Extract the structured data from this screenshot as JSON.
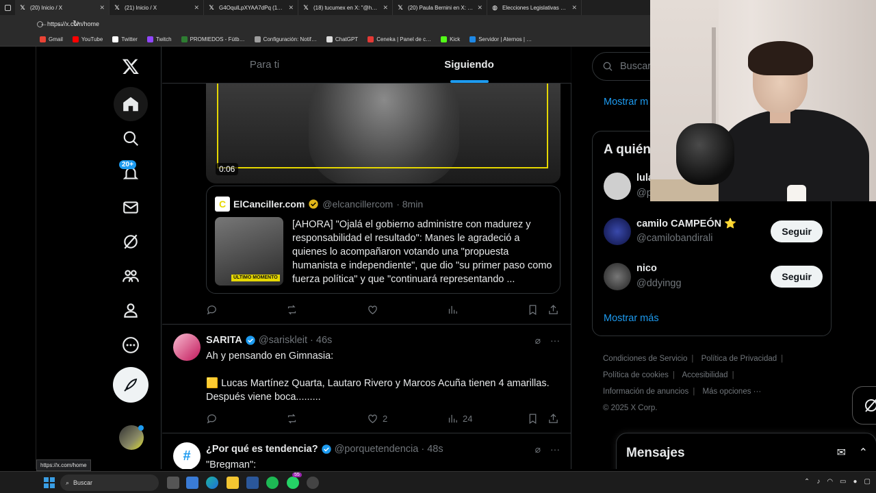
{
  "browser": {
    "tabs": [
      {
        "title": "(20) Inicio / X",
        "icon": "x-logo-icon",
        "active": true
      },
      {
        "title": "(21) Inicio / X",
        "icon": "x-logo-icon"
      },
      {
        "title": "G4OqulLpXYAA7dPq (1152…",
        "icon": "x-logo-icon"
      },
      {
        "title": "(18) tucumex en X: \"@hail_…",
        "icon": "x-logo-icon"
      },
      {
        "title": "(20) Paula Bernini en X: \"GA…",
        "icon": "x-logo-icon"
      },
      {
        "title": "Elecciones Legislativas 2025",
        "icon": "globe-icon"
      }
    ],
    "url": "https://x.com/home",
    "bookmarks": [
      {
        "label": "Gmail",
        "color": "#ea4335"
      },
      {
        "label": "YouTube",
        "color": "#ff0000"
      },
      {
        "label": "Twitter",
        "color": "#ffffff"
      },
      {
        "label": "Twitch",
        "color": "#9146ff"
      },
      {
        "label": "PROMIEDOS - Fútb…",
        "color": "#2e7d32"
      },
      {
        "label": "Configuración: Notif…",
        "color": "#9e9e9e"
      },
      {
        "label": "ChatGPT",
        "color": "#dddddd"
      },
      {
        "label": "Ceneka | Panel de c…",
        "color": "#e53935"
      },
      {
        "label": "Kick",
        "color": "#53fc18"
      },
      {
        "label": "Servidor | Aternos | …",
        "color": "#1e88e5"
      }
    ],
    "status_url": "https://x.com/home"
  },
  "nav": {
    "notifications_badge": "20+"
  },
  "feed": {
    "tabs": [
      "Para ti",
      "Siguiendo"
    ],
    "active_tab": "Siguiendo",
    "video_time": "0:06",
    "quote": {
      "logo_letter": "C",
      "name": "ElCanciller.com",
      "handle": "@elcancillercom",
      "time": "· 8min",
      "thumb_tag": "ÚLTIMO MOMENTO",
      "text": "[AHORA] \"Ojalá el gobierno administre con madurez y responsabilidad el resultado\": Manes le agradeció a quienes lo acompañaron votando una \"propuesta humanista e independiente\", que dio \"su primer paso como fuerza política\" y que \"continuará representando ..."
    },
    "tweets": [
      {
        "name": "SARITA",
        "handle": "@sariskleit",
        "time": "· 46s",
        "text_1": "Ah y pensando en Gimnasia:",
        "text_2": "🟨 Lucas Martínez Quarta, Lautaro Rivero y Marcos Acuña tienen 4 amarillas. Después viene boca.........",
        "likes": "2",
        "views": "24"
      },
      {
        "name": "¿Por qué es tendencia?",
        "handle": "@porquetendencia",
        "time": "· 48s",
        "text_1": "\"Bregman\":"
      }
    ]
  },
  "right": {
    "search_placeholder": "Buscar",
    "show_more_top": "Mostrar m",
    "who_title": "A quién",
    "who": [
      {
        "name": "lula",
        "handle": "@p",
        "color": "#cfcfcf"
      },
      {
        "name": "camilo CAMPEÓN ⭐",
        "handle": "@camilobandirali",
        "follow": "Seguir",
        "color": "#1a237e"
      },
      {
        "name": "nico",
        "handle": "@ddyingg",
        "follow": "Seguir",
        "color": "#444444"
      }
    ],
    "show_more": "Mostrar más",
    "footer": {
      "row1": [
        "Condiciones de Servicio",
        "Política de Privacidad"
      ],
      "row2": [
        "Política de cookies",
        "Accesibilidad"
      ],
      "row3": [
        "Información de anuncios",
        "Más opciones ···"
      ],
      "copyright": "© 2025 X Corp."
    },
    "messages_title": "Mensajes"
  },
  "taskbar": {
    "search": "Buscar",
    "whatsapp_badge": "55"
  },
  "colors": {
    "accent": "#1d9bf0",
    "background": "#000000",
    "text": "#e7e9ea",
    "muted": "#71767b"
  }
}
